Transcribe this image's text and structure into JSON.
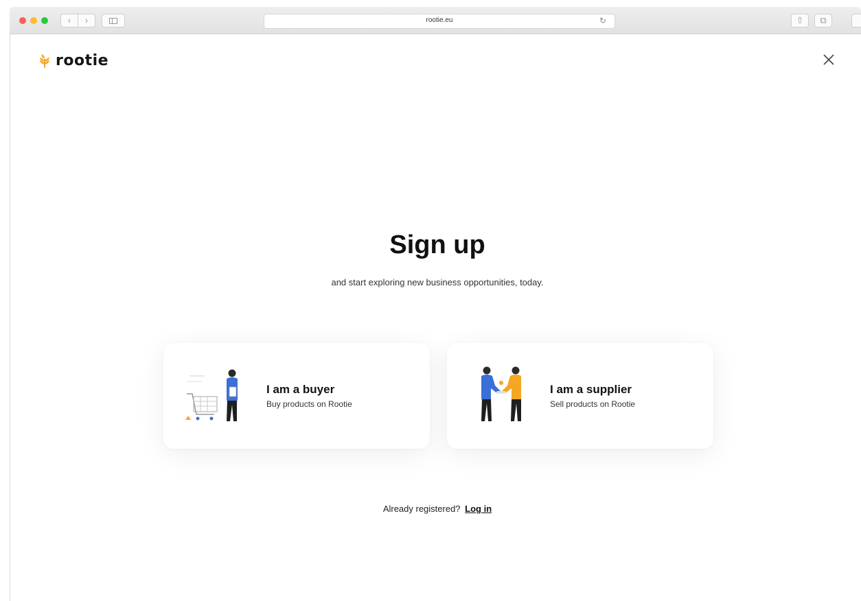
{
  "browser": {
    "url": "rootie.eu",
    "back_glyph": "‹",
    "forward_glyph": "›",
    "reload_glyph": "↻",
    "share_glyph": "⇧",
    "tabs_glyph": "⧉"
  },
  "header": {
    "logo_text": "rootie",
    "close_icon": "close-icon"
  },
  "main": {
    "title": "Sign up",
    "subtitle": "and start exploring new business opportunities, today."
  },
  "cards": {
    "buyer": {
      "title": "I am a buyer",
      "subtitle": "Buy products on Rootie",
      "icon": "shopping-cart-person-illustration"
    },
    "supplier": {
      "title": "I am a supplier",
      "subtitle": "Sell products on Rootie",
      "icon": "handshake-illustration"
    }
  },
  "footer": {
    "already_text": "Already registered?",
    "login_label": "Log in"
  },
  "colors": {
    "brand_orange": "#f5a623",
    "person_blue": "#3b6fd8",
    "text_dark": "#111111"
  }
}
